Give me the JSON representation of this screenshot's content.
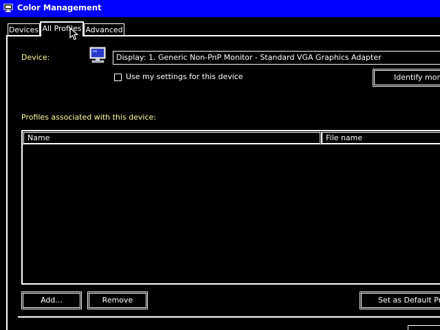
{
  "window": {
    "title": "Color Management",
    "icon": "color-management-icon"
  },
  "tabs": [
    {
      "label": "Devices",
      "selected": false
    },
    {
      "label": "All Profiles",
      "selected": true
    },
    {
      "label": "Advanced",
      "selected": false
    }
  ],
  "device": {
    "label": "Device:",
    "selected_value": "Display: 1. Generic Non-PnP Monitor - Standard VGA Graphics Adapter",
    "icon": "monitor-icon",
    "use_settings_label": "Use my settings for this device",
    "use_settings_checked": false,
    "identify_label": "Identify monitors"
  },
  "profiles": {
    "label": "Profiles associated with this device:",
    "columns": [
      "Name",
      "File name"
    ],
    "rows": []
  },
  "buttons": {
    "add": "Add...",
    "remove": "Remove",
    "set_default": "Set as Default Profile"
  },
  "colors": {
    "titlebar": "#0000ff",
    "background": "#000000",
    "text": "#ffffff",
    "label_text": "#ffff9e"
  }
}
